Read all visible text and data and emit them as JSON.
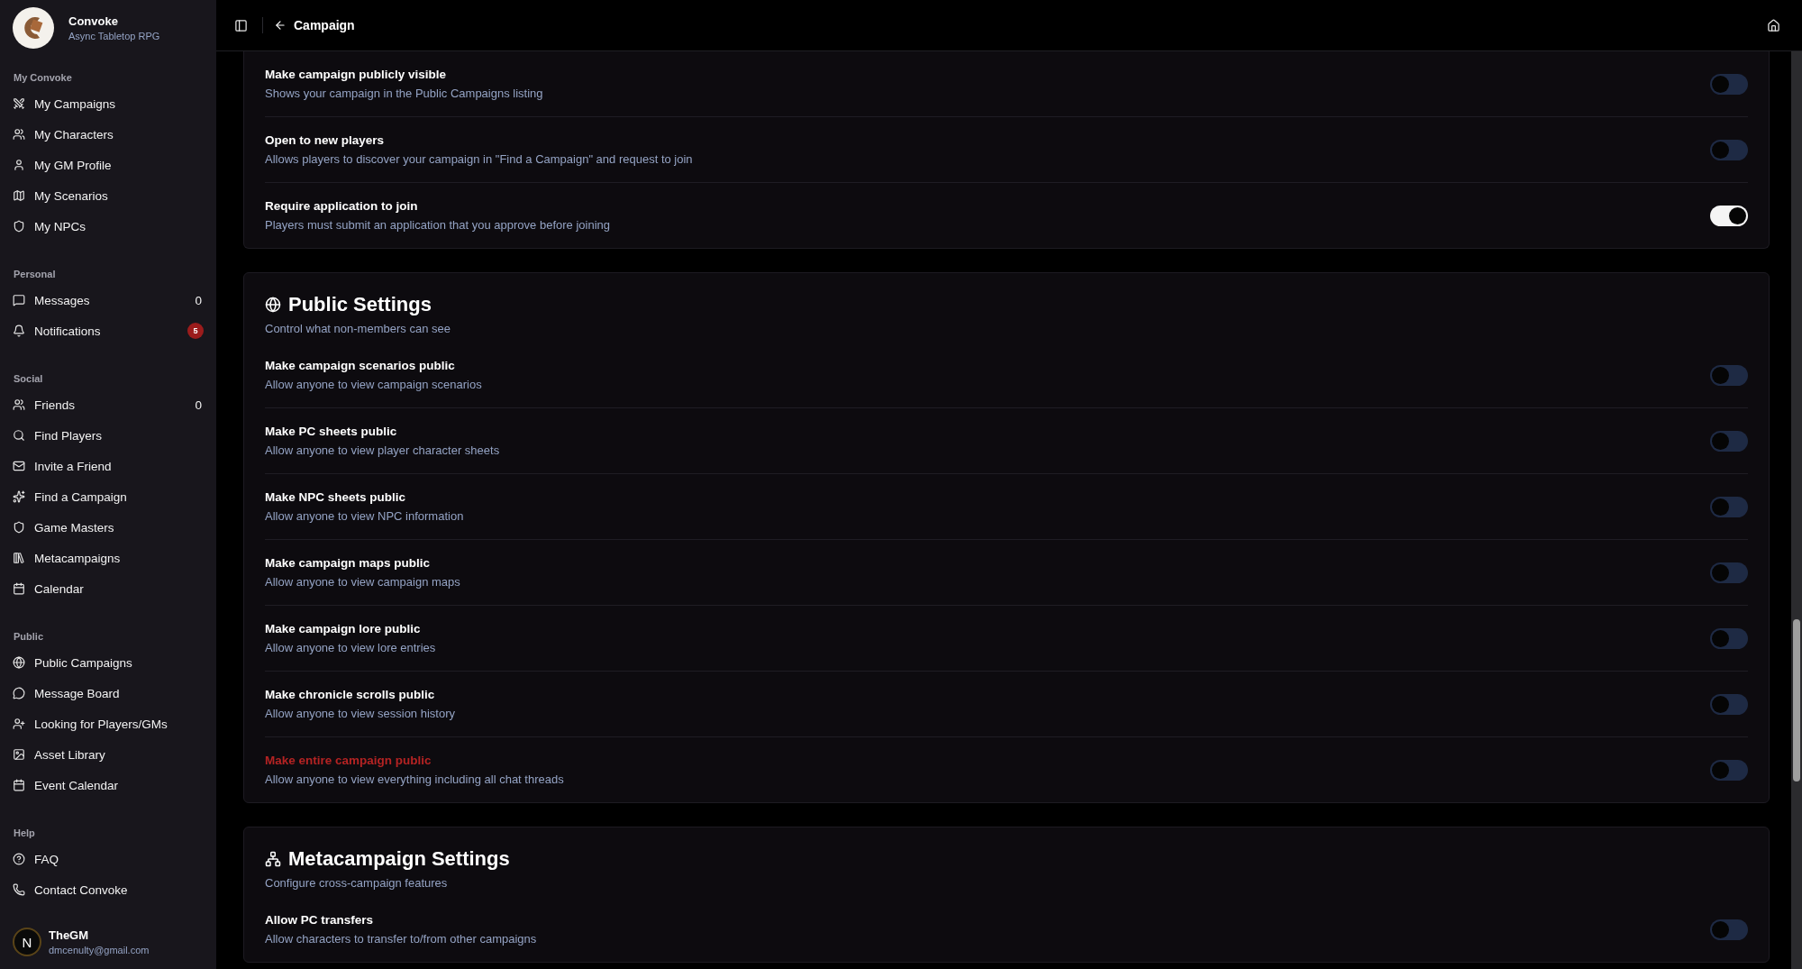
{
  "app": {
    "name": "Convoke",
    "tagline": "Async Tabletop RPG"
  },
  "sidebar": {
    "sections": [
      {
        "label": "My Convoke",
        "items": [
          {
            "label": "My Campaigns"
          },
          {
            "label": "My Characters"
          },
          {
            "label": "My GM Profile"
          },
          {
            "label": "My Scenarios"
          },
          {
            "label": "My NPCs"
          }
        ]
      },
      {
        "label": "Personal",
        "items": [
          {
            "label": "Messages",
            "count": "0"
          },
          {
            "label": "Notifications",
            "badge": "5"
          }
        ]
      },
      {
        "label": "Social",
        "items": [
          {
            "label": "Friends",
            "count": "0"
          },
          {
            "label": "Find Players"
          },
          {
            "label": "Invite a Friend"
          },
          {
            "label": "Find a Campaign"
          },
          {
            "label": "Game Masters"
          },
          {
            "label": "Metacampaigns"
          },
          {
            "label": "Calendar"
          }
        ]
      },
      {
        "label": "Public",
        "items": [
          {
            "label": "Public Campaigns"
          },
          {
            "label": "Message Board"
          },
          {
            "label": "Looking for Players/GMs"
          },
          {
            "label": "Asset Library"
          },
          {
            "label": "Event Calendar"
          }
        ]
      },
      {
        "label": "Help",
        "items": [
          {
            "label": "FAQ"
          },
          {
            "label": "Contact Convoke"
          }
        ]
      }
    ],
    "user": {
      "avatar_letter": "N",
      "name": "TheGM",
      "email": "dmcenulty@gmail.com"
    }
  },
  "header": {
    "back_label": "Campaign"
  },
  "cards": [
    {
      "rows": [
        {
          "kind": "normal",
          "title": "Make campaign publicly visible",
          "description": "Shows your campaign in the Public Campaigns listing",
          "on": false
        },
        {
          "kind": "normal",
          "title": "Open to new players",
          "description": "Allows players to discover your campaign in \"Find a Campaign\" and request to join",
          "on": false
        },
        {
          "kind": "normal",
          "title": "Require application to join",
          "description": "Players must submit an application that you approve before joining",
          "on": true
        }
      ]
    },
    {
      "title": "Public Settings",
      "subtitle": "Control what non-members can see",
      "rows": [
        {
          "kind": "normal",
          "title": "Make campaign scenarios public",
          "description": "Allow anyone to view campaign scenarios",
          "on": false
        },
        {
          "kind": "normal",
          "title": "Make PC sheets public",
          "description": "Allow anyone to view player character sheets",
          "on": false
        },
        {
          "kind": "normal",
          "title": "Make NPC sheets public",
          "description": "Allow anyone to view NPC information",
          "on": false
        },
        {
          "kind": "normal",
          "title": "Make campaign maps public",
          "description": "Allow anyone to view campaign maps",
          "on": false
        },
        {
          "kind": "normal",
          "title": "Make campaign lore public",
          "description": "Allow anyone to view lore entries",
          "on": false
        },
        {
          "kind": "normal",
          "title": "Make chronicle scrolls public",
          "description": "Allow anyone to view session history",
          "on": false
        },
        {
          "kind": "danger",
          "title": "Make entire campaign public",
          "description": "Allow anyone to view everything including all chat threads",
          "on": false
        }
      ]
    },
    {
      "title": "Metacampaign Settings",
      "subtitle": "Configure cross-campaign features",
      "rows": [
        {
          "kind": "normal",
          "title": "Allow PC transfers",
          "description": "Allow characters to transfer to/from other campaigns",
          "on": false
        }
      ]
    }
  ]
}
